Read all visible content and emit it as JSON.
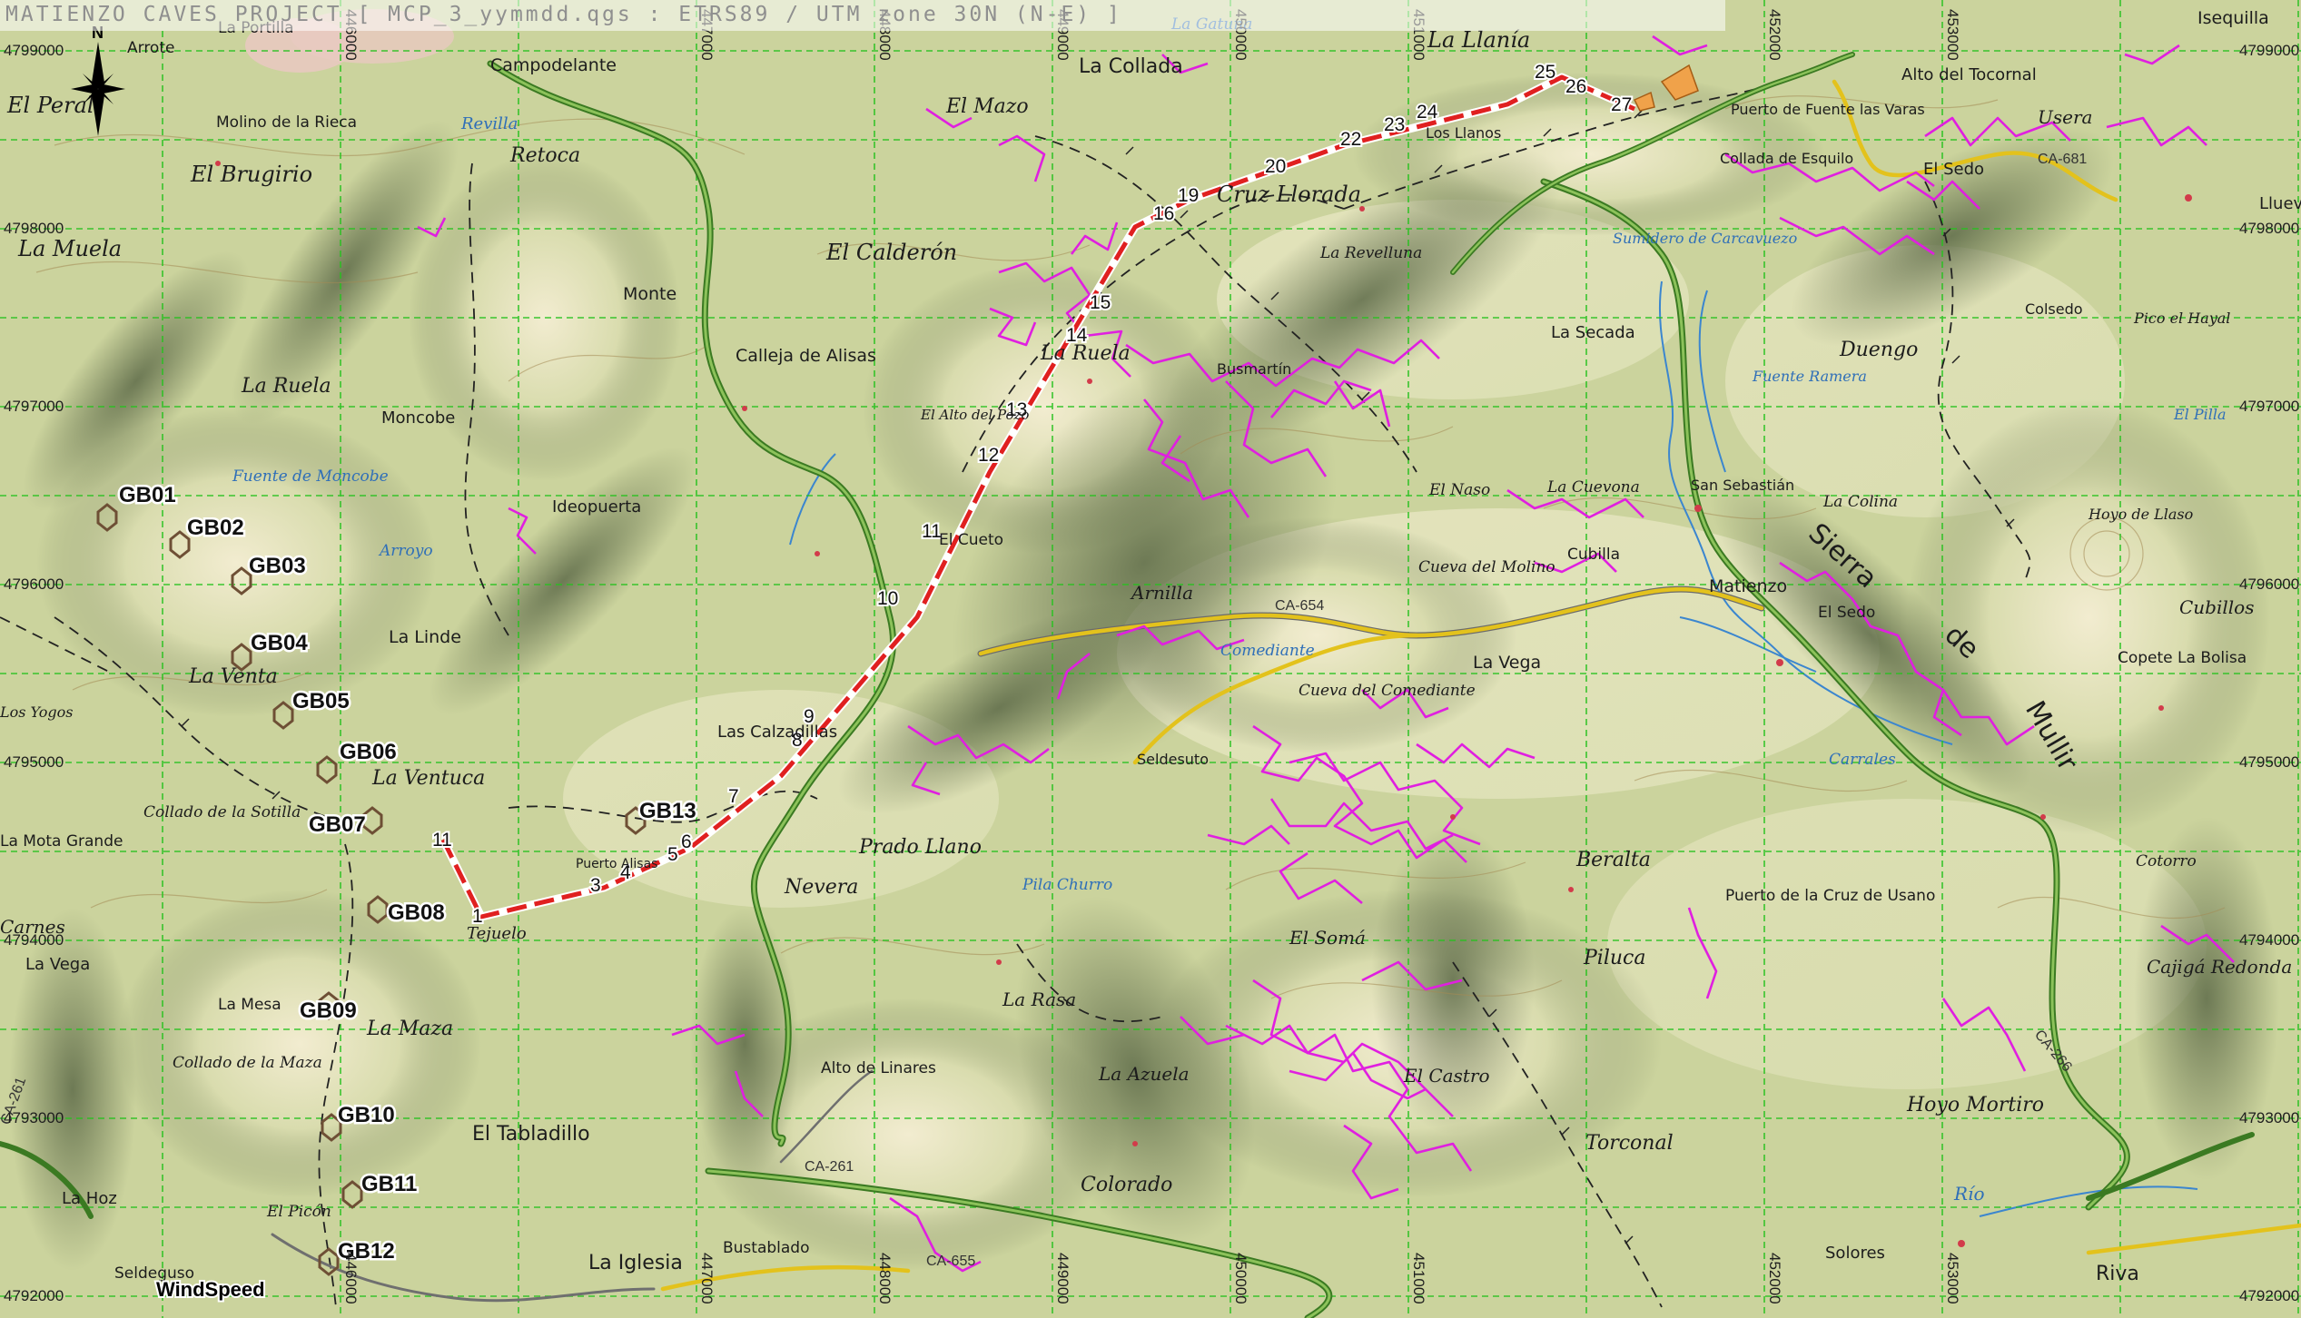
{
  "title": "MATIENZO CAVES PROJECT [ MCP_3_yymmdd.qgs : ETRS89 / UTM zone 30N (N-E) ]",
  "north_label": "N",
  "windspeed_label": "WindSpeed",
  "colors": {
    "terrain": "#cfd6a4",
    "grid": "#27c21f",
    "route": "#e02020",
    "caves": "#e01fe0",
    "road_main": "#4a8f2a",
    "road_regional": "#e3c21c",
    "river": "#3b86cf"
  },
  "coords": {
    "northings_left": [
      "4799000",
      "4798000",
      "4797000",
      "4796000",
      "4795000",
      "4794000",
      "4793000",
      "4792000"
    ],
    "northings_right": [
      "4799000",
      "4798000",
      "4797000",
      "4796000",
      "4795000",
      "4794000",
      "4793000",
      "4792000"
    ],
    "eastings_top": [
      "446000",
      "447000",
      "448000",
      "449000",
      "450000",
      "451000",
      "452000",
      "453000"
    ],
    "eastings_bottom": [
      "446000",
      "447000",
      "448000",
      "449000",
      "450000",
      "451000",
      "452000",
      "453000"
    ]
  },
  "stations": [
    "GB01",
    "GB02",
    "GB03",
    "GB04",
    "GB05",
    "GB06",
    "GB07",
    "GB08",
    "GB09",
    "GB10",
    "GB11",
    "GB12",
    "GB13"
  ],
  "route_labels": [
    "1",
    "3",
    "4",
    "5",
    "6",
    "7",
    "8",
    "9",
    "10",
    "11",
    "12",
    "13",
    "14",
    "15",
    "16",
    "19",
    "20",
    "22",
    "23",
    "24",
    "25",
    "26",
    "27",
    "11"
  ],
  "places": {
    "el_peral": "El Peral",
    "molino_rieca": "Molino de la Rieca",
    "el_brugirio": "El Brugirio",
    "la_muela": "La Muela",
    "campodelante": "Campodelante",
    "retoca": "Retoca",
    "revilla": "Revilla",
    "la_collada": "La Collada",
    "el_mazo": "El Mazo",
    "la_llania": "La Llanía",
    "los_llanos": "Los Llanos",
    "puerto_fuente": "Puerto de Fuente las Varas",
    "collada_esquilo": "Collada de Esquilo",
    "alto_tocornal": "Alto del Tocornal",
    "usera": "Usera",
    "llueva": "Llueva",
    "cruz_llorada": "Cruz Llorada",
    "el_calderon": "El Calderón",
    "la_revelluna": "La Revelluna",
    "sumidero": "Sumidero de Carcavuezo",
    "monte": "Monte",
    "calleja_alisas": "Calleja de Alisas",
    "la_ruela_left": "La Ruela",
    "la_ruela": "La Ruela",
    "la_secada": "La Secada",
    "duengo": "Duengo",
    "colsedo": "Colsedo",
    "pico_hayal": "Pico el Hayal",
    "moncobe": "Moncobe",
    "fuente_moncobe": "Fuente de Moncobe",
    "alto_del_pozo": "El Alto del Pozo",
    "busmartin": "Busmartín",
    "fuente_ramera": "Fuente Ramera",
    "el_pilla": "El Pilla",
    "el_naso": "El Naso",
    "la_cuevona": "La Cuevona",
    "san_sebastian": "San Sebastián",
    "la_colina": "La Colina",
    "ideopuerta": "Ideopuerta",
    "el_cueto": "El Cueto",
    "cueva_molino": "Cueva del Molino",
    "cubilla": "Cubilla",
    "matienzo": "Matienzo",
    "el_sedo": "El Sedo",
    "hoyo_llaso": "Hoyo de Llaso",
    "cubillos": "Cubillos",
    "sierra": "Sierra",
    "de": "de",
    "mullir": "Mullir",
    "arnilla": "Arnilla",
    "la_linde": "La Linde",
    "la_venta": "La Venta",
    "los_yogos": "Los Yogos",
    "comediante": "Comediante",
    "la_vega_c": "La Vega",
    "copete": "Copete La Bolisa",
    "cueva_comediante": "Cueva del Comediante",
    "las_calzadillas": "Las Calzadillas",
    "seldesuto": "Seldesuto",
    "carrales": "Carrales",
    "la_ventuca": "La Ventuca",
    "collado_sotilla": "Collado de la Sotilla",
    "mota_grande": "La Mota Grande",
    "prado_llano": "Prado Llano",
    "nevera": "Nevera",
    "pila_churro": "Pila Churro",
    "beralta": "Beralta",
    "puerto_usano": "Puerto de la Cruz de Usano",
    "cotorro": "Cotorro",
    "puerto_alisas": "Puerto Alisas",
    "tejuelo": "Tejuelo",
    "el_soma": "El Somá",
    "piluca": "Piluca",
    "cajigal": "Cajigá Redonda",
    "carnes": "Carnes",
    "la_vega_l": "La Vega",
    "la_mesa": "La Mesa",
    "la_maza": "La Maza",
    "collado_maza": "Collado de la Maza",
    "la_rasa": "La Rasa",
    "alto_linares": "Alto de Linares",
    "la_azuela": "La Azuela",
    "el_castro": "El Castro",
    "hoyo_mortiro": "Hoyo Mortiro",
    "el_tabladillo": "El Tabladillo",
    "torconal": "Torconal",
    "colorado": "Colorado",
    "la_hoz": "La Hoz",
    "el_picon": "El Picón",
    "seldeguso": "Seldeguso",
    "la_iglesia": "La Iglesia",
    "bustablado": "Bustablado",
    "solores": "Solores",
    "riva": "Riva",
    "rio": "Río",
    "la_portilla": "La Portilla",
    "arrote": "Arrote",
    "la_gatuna": "La Gatuna",
    "isequilla": "Isequilla",
    "el_sedo_top": "El Sedo",
    "arroyo": "Arroyo"
  },
  "road_codes": {
    "ca681": "CA-681",
    "ca654": "CA-654",
    "ca261": "CA-261",
    "ca655": "CA-655",
    "ca266": "CA-266",
    "ca261b": "CA-261"
  }
}
